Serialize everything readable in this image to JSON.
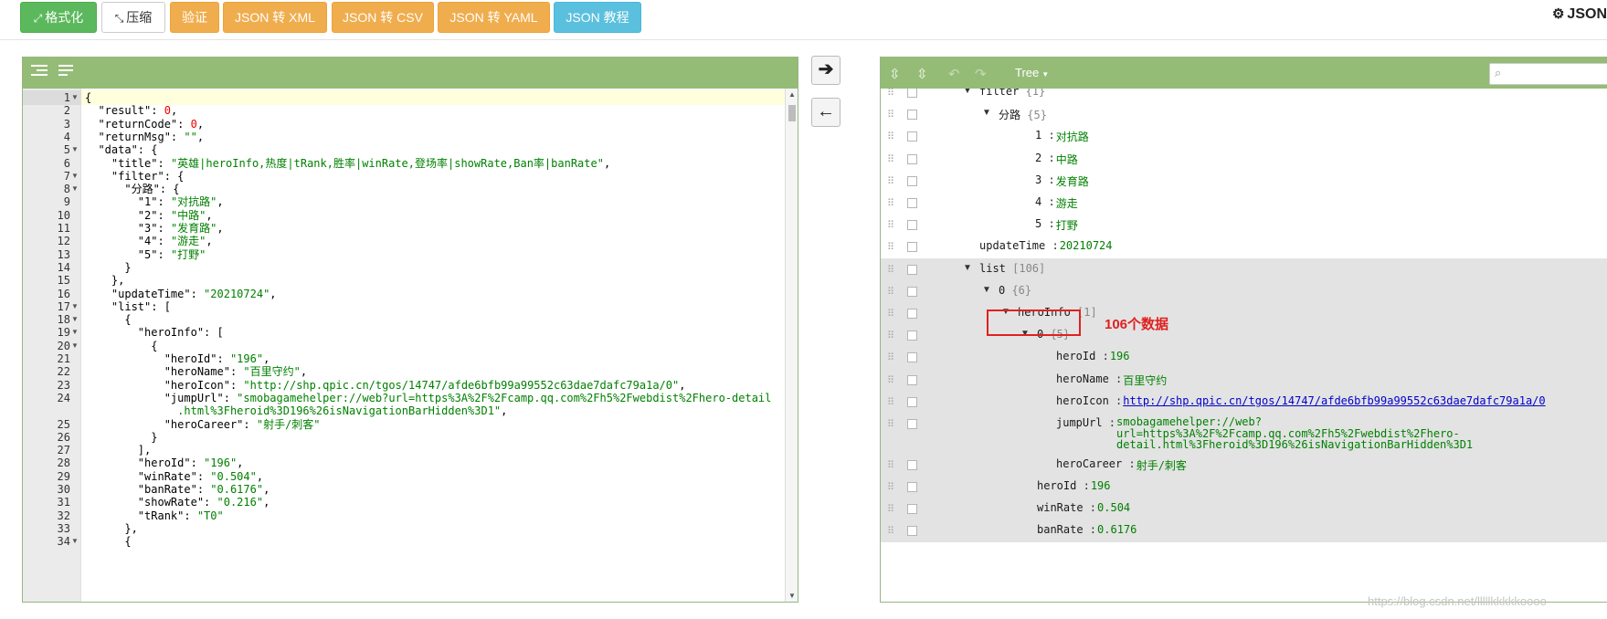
{
  "toolbar": {
    "format_label": "格式化",
    "compress_label": "压缩",
    "validate_label": "验证",
    "to_xml_label": "JSON 转 XML",
    "to_csv_label": "JSON 转 CSV",
    "to_yaml_label": "JSON 转 YAML",
    "tutorial_label": "JSON 教程",
    "brand": "JSON"
  },
  "left_editor": {
    "lines": [
      {
        "n": "1",
        "fold": true,
        "html": [
          [
            "p",
            "{"
          ]
        ]
      },
      {
        "n": "2",
        "fold": false,
        "html": [
          [
            "k",
            "  \"result\""
          ],
          [
            "p",
            ": "
          ],
          [
            "n",
            "0"
          ],
          [
            "p",
            ","
          ]
        ]
      },
      {
        "n": "3",
        "fold": false,
        "html": [
          [
            "k",
            "  \"returnCode\""
          ],
          [
            "p",
            ": "
          ],
          [
            "n",
            "0"
          ],
          [
            "p",
            ","
          ]
        ]
      },
      {
        "n": "4",
        "fold": false,
        "html": [
          [
            "k",
            "  \"returnMsg\""
          ],
          [
            "p",
            ": "
          ],
          [
            "s",
            "\"\""
          ],
          [
            "p",
            ","
          ]
        ]
      },
      {
        "n": "5",
        "fold": true,
        "html": [
          [
            "k",
            "  \"data\""
          ],
          [
            "p",
            ": {"
          ]
        ]
      },
      {
        "n": "6",
        "fold": false,
        "html": [
          [
            "k",
            "    \"title\""
          ],
          [
            "p",
            ": "
          ],
          [
            "s",
            "\"英雄|heroInfo,热度|tRank,胜率|winRate,登场率|showRate,Ban率|banRate\""
          ],
          [
            "p",
            ","
          ]
        ]
      },
      {
        "n": "7",
        "fold": true,
        "html": [
          [
            "k",
            "    \"filter\""
          ],
          [
            "p",
            ": {"
          ]
        ]
      },
      {
        "n": "8",
        "fold": true,
        "html": [
          [
            "k",
            "      \"分路\""
          ],
          [
            "p",
            ": {"
          ]
        ]
      },
      {
        "n": "9",
        "fold": false,
        "html": [
          [
            "k",
            "        \"1\""
          ],
          [
            "p",
            ": "
          ],
          [
            "s",
            "\"对抗路\""
          ],
          [
            "p",
            ","
          ]
        ]
      },
      {
        "n": "10",
        "fold": false,
        "html": [
          [
            "k",
            "        \"2\""
          ],
          [
            "p",
            ": "
          ],
          [
            "s",
            "\"中路\""
          ],
          [
            "p",
            ","
          ]
        ]
      },
      {
        "n": "11",
        "fold": false,
        "html": [
          [
            "k",
            "        \"3\""
          ],
          [
            "p",
            ": "
          ],
          [
            "s",
            "\"发育路\""
          ],
          [
            "p",
            ","
          ]
        ]
      },
      {
        "n": "12",
        "fold": false,
        "html": [
          [
            "k",
            "        \"4\""
          ],
          [
            "p",
            ": "
          ],
          [
            "s",
            "\"游走\""
          ],
          [
            "p",
            ","
          ]
        ]
      },
      {
        "n": "13",
        "fold": false,
        "html": [
          [
            "k",
            "        \"5\""
          ],
          [
            "p",
            ": "
          ],
          [
            "s",
            "\"打野\""
          ]
        ]
      },
      {
        "n": "14",
        "fold": false,
        "html": [
          [
            "p",
            "      }"
          ]
        ]
      },
      {
        "n": "15",
        "fold": false,
        "html": [
          [
            "p",
            "    },"
          ]
        ]
      },
      {
        "n": "16",
        "fold": false,
        "html": [
          [
            "k",
            "    \"updateTime\""
          ],
          [
            "p",
            ": "
          ],
          [
            "s",
            "\"20210724\""
          ],
          [
            "p",
            ","
          ]
        ]
      },
      {
        "n": "17",
        "fold": true,
        "html": [
          [
            "k",
            "    \"list\""
          ],
          [
            "p",
            ": ["
          ]
        ]
      },
      {
        "n": "18",
        "fold": true,
        "html": [
          [
            "p",
            "      {"
          ]
        ]
      },
      {
        "n": "19",
        "fold": true,
        "html": [
          [
            "k",
            "        \"heroInfo\""
          ],
          [
            "p",
            ": ["
          ]
        ]
      },
      {
        "n": "20",
        "fold": true,
        "html": [
          [
            "p",
            "          {"
          ]
        ]
      },
      {
        "n": "21",
        "fold": false,
        "html": [
          [
            "k",
            "            \"heroId\""
          ],
          [
            "p",
            ": "
          ],
          [
            "s",
            "\"196\""
          ],
          [
            "p",
            ","
          ]
        ]
      },
      {
        "n": "22",
        "fold": false,
        "html": [
          [
            "k",
            "            \"heroName\""
          ],
          [
            "p",
            ": "
          ],
          [
            "s",
            "\"百里守约\""
          ],
          [
            "p",
            ","
          ]
        ]
      },
      {
        "n": "23",
        "fold": false,
        "html": [
          [
            "k",
            "            \"heroIcon\""
          ],
          [
            "p",
            ": "
          ],
          [
            "s",
            "\"http://shp.qpic.cn/tgos/14747/afde6bfb99a99552c63dae7dafc79a1a/0\""
          ],
          [
            "p",
            ","
          ]
        ]
      },
      {
        "n": "24",
        "fold": false,
        "html": [
          [
            "k",
            "            \"jumpUrl\""
          ],
          [
            "p",
            ": "
          ],
          [
            "s",
            "\"smobagamehelper://web?url=https%3A%2F%2Fcamp.qq.com%2Fh5%2Fwebdist%2Fhero-detail"
          ]
        ]
      },
      {
        "n": "",
        "fold": false,
        "html": [
          [
            "s",
            "              .html%3Fheroid%3D196%26isNavigationBarHidden%3D1\""
          ],
          [
            "p",
            ","
          ]
        ]
      },
      {
        "n": "25",
        "fold": false,
        "html": [
          [
            "k",
            "            \"heroCareer\""
          ],
          [
            "p",
            ": "
          ],
          [
            "s",
            "\"射手/刺客\""
          ]
        ]
      },
      {
        "n": "26",
        "fold": false,
        "html": [
          [
            "p",
            "          }"
          ]
        ]
      },
      {
        "n": "27",
        "fold": false,
        "html": [
          [
            "p",
            "        ],"
          ]
        ]
      },
      {
        "n": "28",
        "fold": false,
        "html": [
          [
            "k",
            "        \"heroId\""
          ],
          [
            "p",
            ": "
          ],
          [
            "s",
            "\"196\""
          ],
          [
            "p",
            ","
          ]
        ]
      },
      {
        "n": "29",
        "fold": false,
        "html": [
          [
            "k",
            "        \"winRate\""
          ],
          [
            "p",
            ": "
          ],
          [
            "s",
            "\"0.504\""
          ],
          [
            "p",
            ","
          ]
        ]
      },
      {
        "n": "30",
        "fold": false,
        "html": [
          [
            "k",
            "        \"banRate\""
          ],
          [
            "p",
            ": "
          ],
          [
            "s",
            "\"0.6176\""
          ],
          [
            "p",
            ","
          ]
        ]
      },
      {
        "n": "31",
        "fold": false,
        "html": [
          [
            "k",
            "        \"showRate\""
          ],
          [
            "p",
            ": "
          ],
          [
            "s",
            "\"0.216\""
          ],
          [
            "p",
            ","
          ]
        ]
      },
      {
        "n": "32",
        "fold": false,
        "html": [
          [
            "k",
            "        \"tRank\""
          ],
          [
            "p",
            ": "
          ],
          [
            "s",
            "\"T0\""
          ]
        ]
      },
      {
        "n": "33",
        "fold": false,
        "html": [
          [
            "p",
            "      },"
          ]
        ]
      },
      {
        "n": "34",
        "fold": true,
        "html": [
          [
            "p",
            "      {"
          ]
        ]
      }
    ]
  },
  "arrows": {
    "right": "➔",
    "left": "🡐"
  },
  "tree_panel": {
    "mode_label": "Tree",
    "rows": [
      {
        "indent": 0,
        "tri": true,
        "key": "filter",
        "count": "{1}",
        "val": "",
        "shaded": false
      },
      {
        "indent": 1,
        "tri": true,
        "key": "分路",
        "count": "{5}",
        "val": "",
        "shaded": false
      },
      {
        "indent": 2,
        "tri": false,
        "key": "1",
        "count": "",
        "val": "对抗路",
        "shaded": false
      },
      {
        "indent": 2,
        "tri": false,
        "key": "2",
        "count": "",
        "val": "中路",
        "shaded": false
      },
      {
        "indent": 2,
        "tri": false,
        "key": "3",
        "count": "",
        "val": "发育路",
        "shaded": false
      },
      {
        "indent": 2,
        "tri": false,
        "key": "4",
        "count": "",
        "val": "游走",
        "shaded": false
      },
      {
        "indent": 2,
        "tri": false,
        "key": "5",
        "count": "",
        "val": "打野",
        "shaded": false
      },
      {
        "indent": 0,
        "tri": false,
        "key": "updateTime",
        "count": "",
        "val": "20210724",
        "shaded": false
      },
      {
        "indent": 0,
        "tri": true,
        "key": "list",
        "count": "[106]",
        "val": "",
        "shaded": true
      },
      {
        "indent": 1,
        "tri": true,
        "key": "0",
        "count": "{6}",
        "val": "",
        "shaded": true
      },
      {
        "indent": 2,
        "tri": true,
        "key": "heroInfo",
        "count": "[1]",
        "val": "",
        "shaded": true
      },
      {
        "indent": 3,
        "tri": true,
        "key": "0",
        "count": "{5}",
        "val": "",
        "shaded": true
      },
      {
        "indent": 4,
        "tri": false,
        "key": "heroId",
        "count": "",
        "val": "196",
        "shaded": true
      },
      {
        "indent": 4,
        "tri": false,
        "key": "heroName",
        "count": "",
        "val": "百里守约",
        "shaded": true
      },
      {
        "indent": 4,
        "tri": false,
        "key": "heroIcon",
        "count": "",
        "val": "http://shp.qpic.cn/tgos/14747/afde6bfb99a99552c63dae7dafc79a1a/0",
        "link": true,
        "shaded": true
      },
      {
        "indent": 4,
        "tri": false,
        "key": "jumpUrl",
        "count": "",
        "val": "smobagamehelper://web?\nurl=https%3A%2F%2Fcamp.qq.com%2Fh5%2Fwebdist%2Fhero-\ndetail.html%3Fheroid%3D196%26isNavigationBarHidden%3D1",
        "multi": true,
        "shaded": true
      },
      {
        "indent": 4,
        "tri": false,
        "key": "heroCareer",
        "count": "",
        "val": "射手/刺客",
        "shaded": true
      },
      {
        "indent": 3,
        "tri": false,
        "key": "heroId",
        "count": "",
        "val": "196",
        "shaded": true
      },
      {
        "indent": 3,
        "tri": false,
        "key": "winRate",
        "count": "",
        "val": "0.504",
        "shaded": true
      },
      {
        "indent": 3,
        "tri": false,
        "key": "banRate",
        "count": "",
        "val": "0.6176",
        "shaded": true
      }
    ]
  },
  "annotation": "106个数据",
  "watermark": "https://blog.csdn.net/lllllkkkkkoooo"
}
